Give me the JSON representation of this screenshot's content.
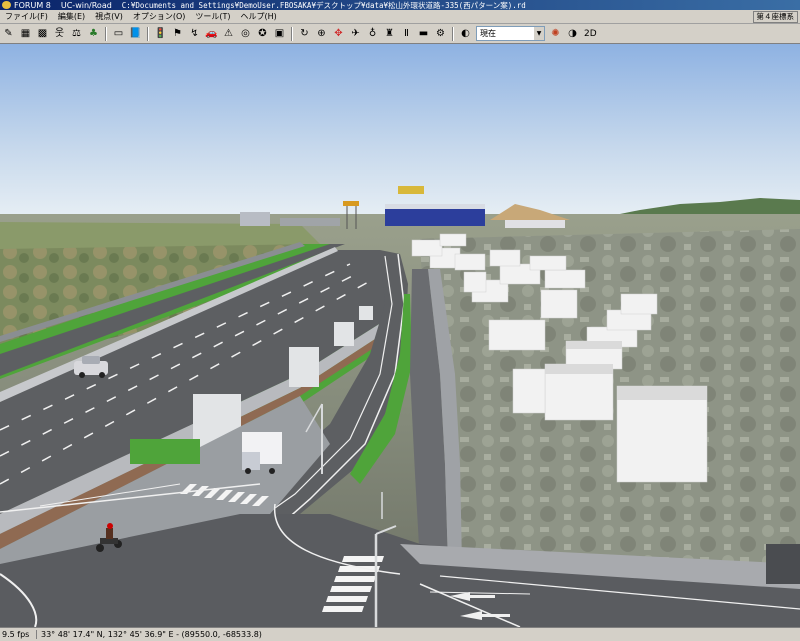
{
  "window": {
    "app_name": "FORUM 8",
    "product": "UC-win/Road",
    "file_path": "C:¥Documents and Settings¥DemoUser.FBOSAKA¥デスクトップ¥data¥松山外環状道路-335(西パターン案).rd",
    "coord_badge": "第４座標系"
  },
  "menu": [
    "ファイル(F)",
    "編集(E)",
    "視点(V)",
    "オプション(O)",
    "ツール(T)",
    "ヘルプ(H)"
  ],
  "toolbar": {
    "time_select": "現在",
    "view_mode": "2D"
  },
  "status": {
    "fps": "9.5 fps",
    "coordinates": "33° 48' 17.4\" N, 132° 45' 36.9\" E  - (89550.0, -68533.8)"
  },
  "colors": {
    "sky_top": "#8eb2e2",
    "sky_horizon": "#e6eef4",
    "road": "#5d5f62",
    "grass": "#4fa43a",
    "title_bar": "#0a246a"
  }
}
